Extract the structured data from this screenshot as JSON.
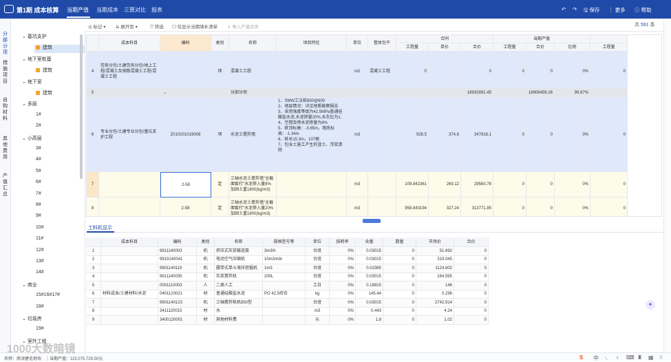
{
  "app": {
    "title": "第1期 成本核算"
  },
  "menu": [
    "当期产值",
    "当期成本",
    "三算对比",
    "报表"
  ],
  "menu_active": 0,
  "titlebar_actions": {
    "save": "保存",
    "more": "更多",
    "help": "帮助"
  },
  "toolbar": {
    "mark": "标记",
    "expand": "展开到",
    "filter": "筛选",
    "only_show": "仅显示当期填补清单",
    "import": "导入产值文件"
  },
  "pager": {
    "prefix": "共",
    "count": "591",
    "suffix": "条"
  },
  "left_rail": [
    "分部分项",
    "措施项目",
    "自购材料",
    "其他费用",
    "产值汇总"
  ],
  "tree": [
    {
      "label": "基坑支护",
      "level": 1,
      "type": "group"
    },
    {
      "label": "建筑",
      "level": 2,
      "type": "leaf",
      "selected": true
    },
    {
      "label": "地下室桩基",
      "level": 1,
      "type": "group"
    },
    {
      "label": "建筑",
      "level": 2,
      "type": "leaf"
    },
    {
      "label": "地下室",
      "level": 1,
      "type": "group"
    },
    {
      "label": "建筑",
      "level": 2,
      "type": "leaf"
    },
    {
      "label": "多层",
      "level": 1,
      "type": "group"
    },
    {
      "label": "1#",
      "level": 2,
      "type": "item"
    },
    {
      "label": "2#",
      "level": 2,
      "type": "item"
    },
    {
      "label": "小高层",
      "level": 1,
      "type": "group"
    },
    {
      "label": "3#",
      "level": 2,
      "type": "item"
    },
    {
      "label": "4#",
      "level": 2,
      "type": "item"
    },
    {
      "label": "5#",
      "level": 2,
      "type": "item"
    },
    {
      "label": "6#",
      "level": 2,
      "type": "item"
    },
    {
      "label": "7#",
      "level": 2,
      "type": "item"
    },
    {
      "label": "8#",
      "level": 2,
      "type": "item"
    },
    {
      "label": "9#",
      "level": 2,
      "type": "item"
    },
    {
      "label": "10#",
      "level": 2,
      "type": "item"
    },
    {
      "label": "11#",
      "level": 2,
      "type": "item"
    },
    {
      "label": "12#",
      "level": 2,
      "type": "item"
    },
    {
      "label": "13#",
      "level": 2,
      "type": "item"
    },
    {
      "label": "14#",
      "level": 2,
      "type": "item"
    },
    {
      "label": "商业",
      "level": 1,
      "type": "group"
    },
    {
      "label": "15#16#17#",
      "level": 2,
      "type": "item"
    },
    {
      "label": "18#",
      "level": 2,
      "type": "item"
    },
    {
      "label": "垃圾房",
      "level": 1,
      "type": "group"
    },
    {
      "label": "19#",
      "level": 2,
      "type": "item"
    },
    {
      "label": "室外工程",
      "level": 1,
      "type": "group"
    }
  ],
  "main_grid": {
    "header_groups": {
      "contract": "合同",
      "current": "当期产值"
    },
    "headers": [
      "",
      "成本科目",
      "编码",
      "类别",
      "名称",
      "项目特征",
      "单位",
      "整体包干",
      "工程量",
      "单价",
      "合价",
      "工程量",
      "合价",
      "比例",
      "工程量"
    ],
    "rows": [
      {
        "no": "4",
        "subject": "劳务分包/土建劳务分包/地上工程/混凝土及钢筋混凝土工程/混凝土工程",
        "code": "",
        "cat": "项",
        "name": "混凝土工程",
        "feature": "",
        "unit": "m2",
        "lump": "混凝土工程",
        "qty": "0",
        "price": "",
        "total": "0",
        "cqty": "0",
        "ctotal": "0",
        "ratio": "0%",
        "q2": "0",
        "bg": "#dfe9fb"
      },
      {
        "no": "5",
        "subject": "",
        "code": "",
        "cat": "",
        "name": "分部分项",
        "feature": "",
        "unit": "",
        "lump": "",
        "qty": "",
        "price": "",
        "total": "18932891.45",
        "cqty": "",
        "ctotal": "18908459.26",
        "ratio": "99.87%",
        "q2": "",
        "bg": "#e4e6ec"
      },
      {
        "no": "6",
        "subject": "专业分包/土建专业分包/基坑支护工程",
        "code": "Z010201019008",
        "cat": "项",
        "name": "水泥土搅拌墙",
        "feature": "1、SMW工法桩850@600\n2、地层情况：详见地质勘察报告\n3、采用强度等级为42.5MPa普通硅酸盐水泥,水泥掺量20%,水灰比为1.\n4、空搅及喷水泥掺量为8%\n5、桩顶标高：-3.65m，墙底标高：-1.34m\n6、桩长15.3m，107根\n7、包含土施工产生的渣土、浮浆清除",
        "unit": "m3",
        "lump": "",
        "qty": "928.5",
        "price": "374.6",
        "total": "347816.1",
        "cqty": "0",
        "ctotal": "0",
        "ratio": "0%",
        "q2": "0",
        "bg": "#dfe9fb"
      },
      {
        "no": "7",
        "subject": "",
        "code": "2-58",
        "cat": "定",
        "name": "三轴水泥土搅拌墙\"全截面套打\"水泥掺入量8%加固土重1800(kg/m3)",
        "feature": "",
        "unit": "m3",
        "lump": "",
        "qty": "109.842361",
        "price": "269.12",
        "total": "29560.78",
        "cqty": "0",
        "ctotal": "0",
        "ratio": "0%",
        "q2": "0",
        "bg": "#fdfbea"
      },
      {
        "no": "8",
        "subject": "",
        "code": "2-58",
        "cat": "定",
        "name": "三轴水泥土搅拌墙\"全截面套打\"水泥掺入量20%加固土重1800(kg/m3)",
        "feature": "",
        "unit": "m3",
        "lump": "",
        "qty": "958.843194",
        "price": "327.24",
        "total": "313771.85",
        "cqty": "0",
        "ctotal": "0",
        "ratio": "0%",
        "q2": "0",
        "bg": "#fdfbea"
      }
    ]
  },
  "lower_tab": "工料机显示",
  "lower_grid": {
    "headers": [
      "",
      "成本科目",
      "编码",
      "类别",
      "名称",
      "规格型号等",
      "单位",
      "损耗率",
      "含量",
      "数量",
      "市场价",
      "合价"
    ],
    "rows": [
      [
        "1",
        "",
        "9911140003",
        "机",
        "挤压式灰浆输送泵",
        "3m3/h",
        "台班",
        "0%",
        "0.03015",
        "0",
        "51.692",
        "0"
      ],
      [
        "2",
        "",
        "9919140041",
        "机",
        "电动空气压缩机",
        "10m3/min",
        "台班",
        "0%",
        "0.03015",
        "0",
        "319.045",
        "0"
      ],
      [
        "3",
        "",
        "9901140115",
        "机",
        "履带式单斗液压挖掘机",
        "1m3",
        "台班",
        "0%",
        "0.02385",
        "0",
        "1124.602",
        "0"
      ],
      [
        "4",
        "",
        "9911140035",
        "机",
        "灰浆搅拌机",
        "200L",
        "台班",
        "0%",
        "0.03015",
        "0",
        "164.595",
        "0"
      ],
      [
        "5",
        "",
        "0001110003",
        "人",
        "二类人工",
        "",
        "工日",
        "0%",
        "0.18915",
        "0",
        "146",
        "0"
      ],
      [
        "6",
        "材料成本/土建材料/水泥",
        "0401120021",
        "材",
        "普通硅酸盐水泥",
        "PO 42.5综合",
        "kg",
        "0%",
        "145.44",
        "0",
        "0.296",
        "0"
      ],
      [
        "7",
        "",
        "9901140123",
        "机",
        "三轴搅拌桩机850型",
        "",
        "台班",
        "0%",
        "0.03015",
        "0",
        "2742.914",
        "0"
      ],
      [
        "8",
        "",
        "3411120015",
        "材",
        "水",
        "",
        "m3",
        "0%",
        "0.443",
        "0",
        "4.24",
        "0"
      ],
      [
        "9",
        "",
        "3400120001",
        "材",
        "其他材料费",
        "",
        "元",
        "0%",
        "1.8",
        "0",
        "1.02",
        "0"
      ]
    ]
  },
  "status": {
    "text": "名称：南浔建北地块　｜当期产值：115,075,729.50元"
  },
  "watermark": "1000大数暗镜"
}
